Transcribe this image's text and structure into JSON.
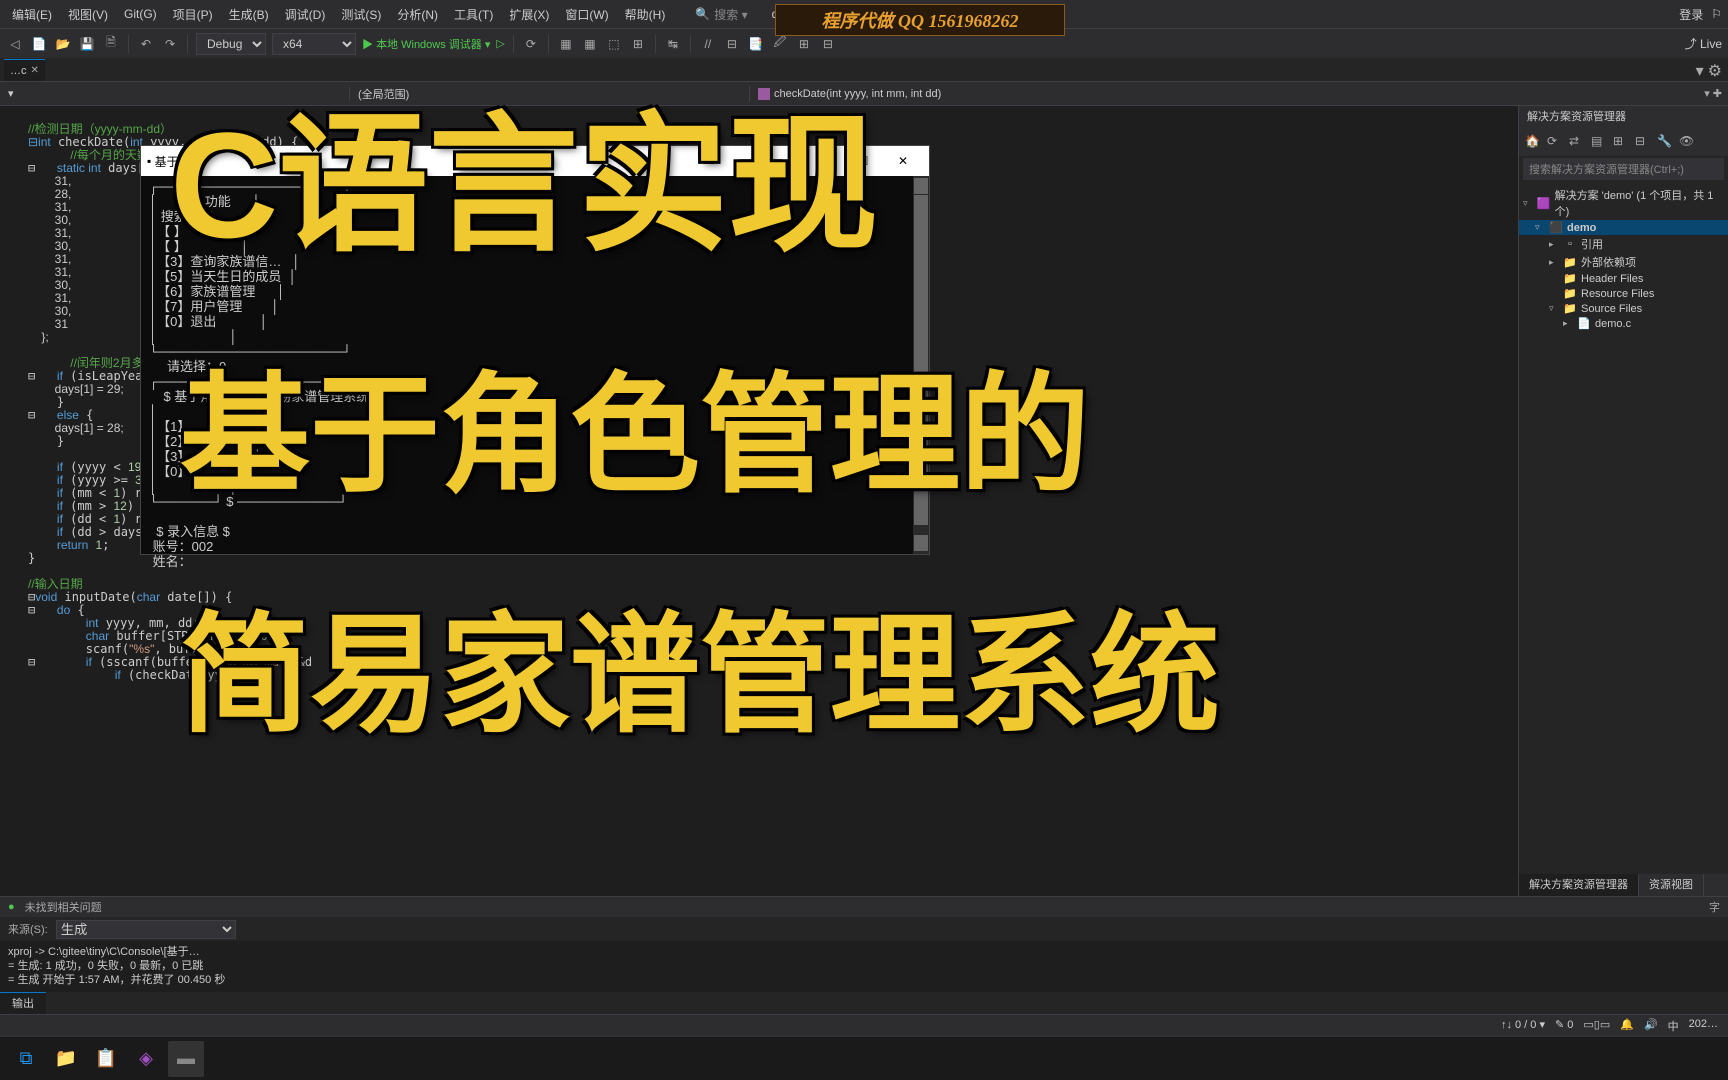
{
  "menu": {
    "items": [
      "编辑(E)",
      "视图(V)",
      "Git(G)",
      "项目(P)",
      "生成(B)",
      "调试(D)",
      "测试(S)",
      "分析(N)",
      "工具(T)",
      "扩展(X)",
      "窗口(W)",
      "帮助(H)"
    ],
    "search": "搜索 ▾",
    "project": "demo",
    "login": "登录",
    "liveShare": "Live"
  },
  "ad": "程序代做 QQ 1561968262",
  "toolbar": {
    "config": "Debug",
    "platform": "x64",
    "debugger": "本地 Windows 调试器"
  },
  "tab": {
    "name": "…c"
  },
  "context": {
    "global": "(全局范围)",
    "member": "checkDate(int yyyy, int mm, int dd)"
  },
  "code": {
    "c1": "//检测日期（yyyy-mm-dd）",
    "c2": "int checkDate(int yyyy, int mm, int dd) {",
    "c3": "    //每个月的天数",
    "c4": "    static int days[]",
    "c5": "        31,",
    "c6": "        28,",
    "c7": "        31,",
    "c8": "        30,",
    "c9": "        31,",
    "c10": "        30,",
    "c11": "        31,",
    "c12": "        31,",
    "c13": "        30,",
    "c14": "        31,",
    "c15": "        30,",
    "c16": "        31",
    "c17": "    };",
    "c18": "",
    "c19": "    //闰年则2月多加1天",
    "c20": "    if (isLeapYear(yy",
    "c21": "        days[1] = 29;",
    "c22": "    }",
    "c23": "    else {",
    "c24": "        days[1] = 28;",
    "c25": "    }",
    "c26": "",
    "c27": "    if (yyyy < 1900) r",
    "c28": "    if (yyyy >= 3000) ",
    "c29": "    if (mm < 1) return",
    "c30": "    if (mm > 12) retu",
    "c31": "    if (dd < 1) return",
    "c32": "    if (dd > days[mm ",
    "c33": "    return 1;",
    "c34": "}",
    "c35": "",
    "c36": "//输入日期",
    "c37": "void inputDate(char date[]) {",
    "c38": "    do {",
    "c39": "        int yyyy, mm, dd;",
    "c40": "        char buffer[STR_LEN] = { 0 };",
    "c41": "        scanf(\"%s\", buffer);",
    "c42": "        if (sscanf(buffer, \"%d-%d-%d\", &",
    "c43": "            if (checkDate(yyy"
  },
  "console": {
    "title": "基于…",
    "lines": [
      "┌────────────────────┐",
      "│      理员功能      │",
      "│ 搜索提取…          │",
      "│【 】               │",
      "│【 】               │",
      "│【3】查询家族谱信…   │",
      "│【5】当天生日的成员  │",
      "│【6】家族谱管理      │",
      "│【7】用户管理        │",
      "│【0】退出            │",
      "│                    │",
      "└────────────────────┘",
      "     请选择：0",
      "┌────────────────────┐",
      "    $ 基于角色管理的简易家谱管理系统 $",
      "│                    │",
      "│【1】                │",
      "│【2】                │",
      "│【3】 母             │",
      "│【0】                │",
      "│                    │",
      "└──────┘ $ ───────────┘",
      "",
      "  $ 录入信息 $",
      " 账号：002",
      " 姓名："
    ]
  },
  "overlays": {
    "t1": "C语言实现",
    "t2": "基于角色管理的",
    "t3": "简易家谱管理系统"
  },
  "statusLine": {
    "noIssues": "未找到相关问题",
    "cursor": "字"
  },
  "output": {
    "srcLabel": "来源(S):",
    "src": "生成",
    "l1": "xproj -> C:\\gitee\\tiny\\C\\Console\\[基于…",
    "l2": "= 生成: 1 成功，0 失败，0 最新，0 已跳",
    "l3": "= 生成 开始于 1:57 AM，并花费了 00.450 秒"
  },
  "outputTab": "输出",
  "explorer": {
    "title": "解决方案资源管理器",
    "search": "搜索解决方案资源管理器(Ctrl+;)",
    "sln": "解决方案 'demo' (1 个项目，共 1 个)",
    "proj": "demo",
    "refs": "引用",
    "ext": "外部依赖项",
    "hdr": "Header Files",
    "res": "Resource Files",
    "src": "Source Files",
    "file": "demo.c",
    "tab1": "解决方案资源管理器",
    "tab2": "资源视图"
  },
  "innerStatus": {
    "nav": "0 / 0",
    "errors": "0",
    "char": "中",
    "year": "202…"
  },
  "taskIcons": [
    "vscode",
    "files",
    "sticky",
    "vs",
    "term"
  ]
}
